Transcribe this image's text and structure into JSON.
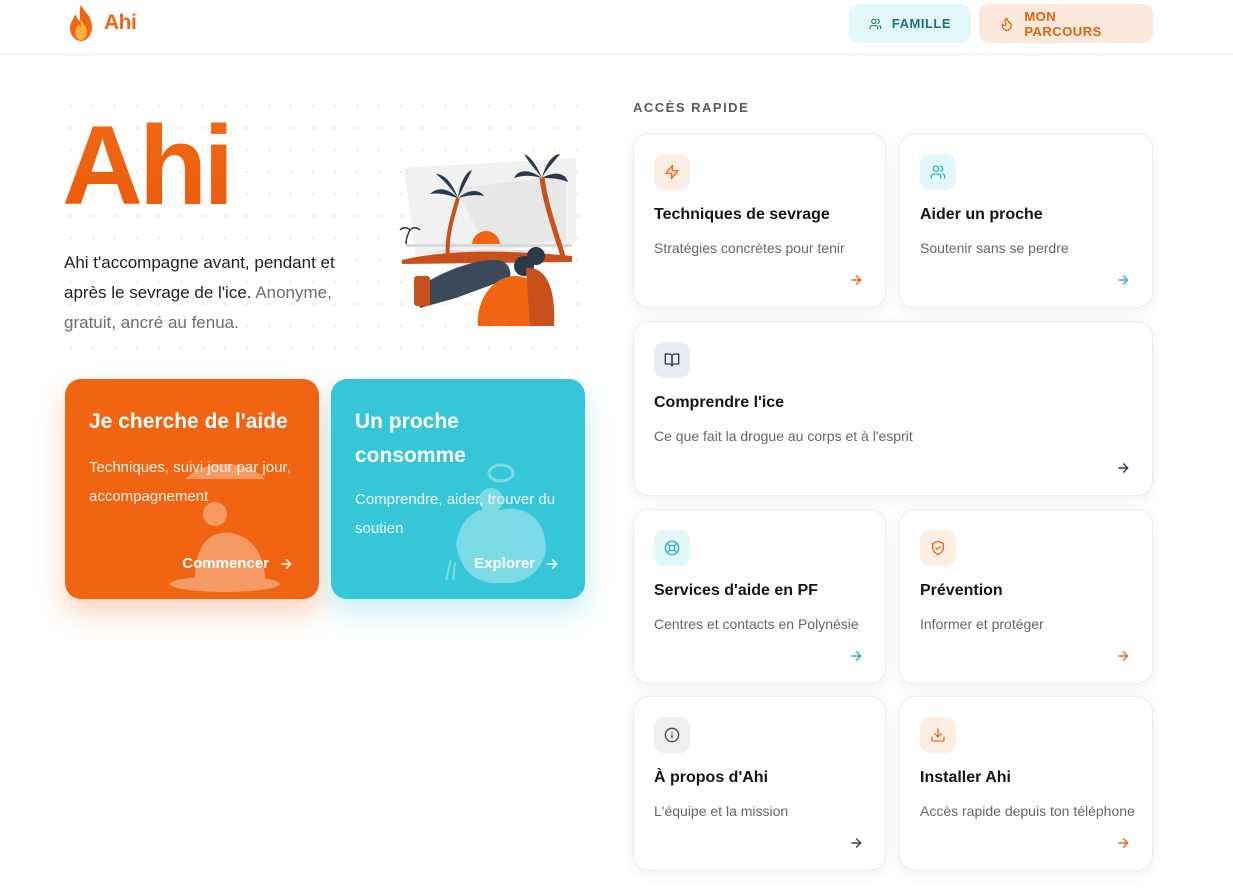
{
  "header": {
    "logo_text": "Ahi",
    "famille_label": "FAMILLE",
    "parcours_label": "MON PARCOURS"
  },
  "hero": {
    "title": "Ahi",
    "text_main": "Ahi t'accompagne avant, pendant et après le sevrage de l'ice.",
    "text_muted": "Anonyme, gratuit, ancré au fenua."
  },
  "cta": [
    {
      "title": "Je cherche de l'aide",
      "subtitle": "Techniques, suivi jour par jour, accompagnement",
      "link": "Commencer"
    },
    {
      "title": "Un proche consomme",
      "subtitle": "Comprendre, aider, trouver du soutien",
      "link": "Explorer"
    }
  ],
  "quick_access": {
    "label": "ACCÈS RAPIDE",
    "cards": [
      {
        "title": "Techniques de sevrage",
        "subtitle": "Stratégies concrètes pour tenir",
        "icon": "zap-icon",
        "accent": "#ec6a1d"
      },
      {
        "title": "Aider un proche",
        "subtitle": "Soutenir sans se perdre",
        "icon": "users-icon",
        "accent": "#2fb3c5"
      },
      {
        "title": "Comprendre l'ice",
        "subtitle": "Ce que fait la drogue au corps et à l'esprit",
        "icon": "book-open-icon",
        "accent": "#2b3656"
      },
      {
        "title": "Services d'aide en PF",
        "subtitle": "Centres et contacts en Polynésie",
        "icon": "life-buoy-icon",
        "accent": "#2fb3c5"
      },
      {
        "title": "Prévention",
        "subtitle": "Informer et protéger",
        "icon": "shield-check-icon",
        "accent": "#ec6a1d"
      },
      {
        "title": "À propos d'Ahi",
        "subtitle": "L'équipe et la mission",
        "icon": "info-icon",
        "accent": "#444444"
      },
      {
        "title": "Installer Ahi",
        "subtitle": "Accès rapide depuis ton téléphone",
        "icon": "download-icon",
        "accent": "#ec6a1d"
      }
    ]
  },
  "colors": {
    "brand_orange": "#f06412",
    "brand_cyan": "#35c6d8"
  }
}
